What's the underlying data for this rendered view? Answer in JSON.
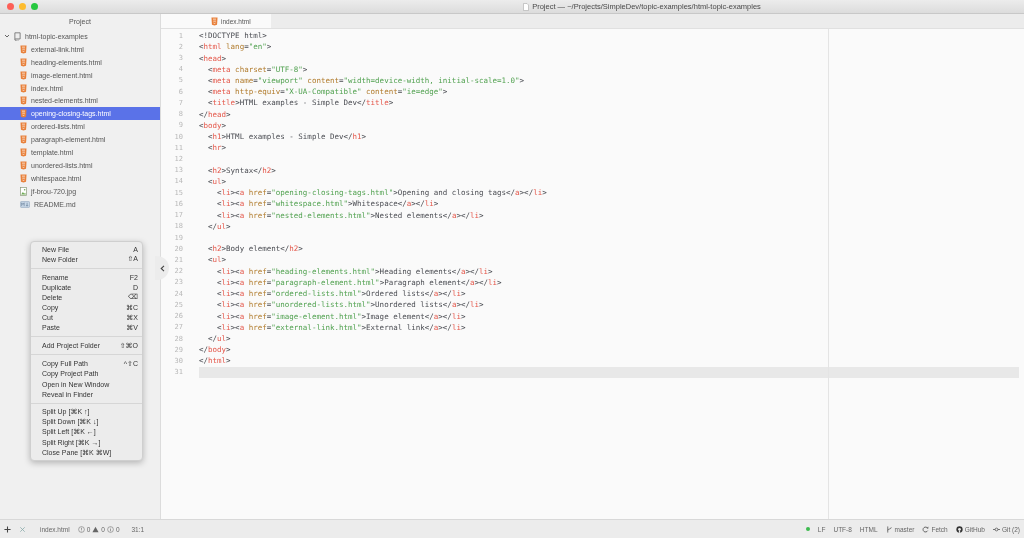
{
  "window": {
    "title": "Project — ~/Projects/SimpleDev/topic-examples/html-topic-examples"
  },
  "sidebar": {
    "title": "Project",
    "tree": [
      {
        "name": "html-topic-examples",
        "kind": "repo",
        "expanded": true,
        "selected": false,
        "children": [
          {
            "name": "external-link.html",
            "kind": "html",
            "selected": false
          },
          {
            "name": "heading-elements.html",
            "kind": "html",
            "selected": false
          },
          {
            "name": "image-element.html",
            "kind": "html",
            "selected": false
          },
          {
            "name": "index.html",
            "kind": "html",
            "selected": false
          },
          {
            "name": "nested-elements.html",
            "kind": "html",
            "selected": false
          },
          {
            "name": "opening-closing-tags.html",
            "kind": "html",
            "selected": true
          },
          {
            "name": "ordered-lists.html",
            "kind": "html",
            "selected": false
          },
          {
            "name": "paragraph-element.html",
            "kind": "html",
            "selected": false
          },
          {
            "name": "template.html",
            "kind": "html",
            "selected": false
          },
          {
            "name": "unordered-lists.html",
            "kind": "html",
            "selected": false
          },
          {
            "name": "whitespace.html",
            "kind": "html",
            "selected": false
          },
          {
            "name": "jf-brou-720.jpg",
            "kind": "image",
            "selected": false
          },
          {
            "name": "README.md",
            "kind": "markdown",
            "selected": false
          }
        ]
      }
    ]
  },
  "context_menu": {
    "groups": [
      [
        {
          "label": "New File",
          "shortcut": "A"
        },
        {
          "label": "New Folder",
          "shortcut": "⇧A"
        }
      ],
      [
        {
          "label": "Rename",
          "shortcut": "F2"
        },
        {
          "label": "Duplicate",
          "shortcut": "D"
        },
        {
          "label": "Delete",
          "shortcut": "⌫"
        },
        {
          "label": "Copy",
          "shortcut": "⌘C"
        },
        {
          "label": "Cut",
          "shortcut": "⌘X"
        },
        {
          "label": "Paste",
          "shortcut": "⌘V"
        }
      ],
      [
        {
          "label": "Add Project Folder",
          "shortcut": "⇧⌘O"
        }
      ],
      [
        {
          "label": "Copy Full Path",
          "shortcut": "^⇧C"
        },
        {
          "label": "Copy Project Path"
        },
        {
          "label": "Open in New Window"
        },
        {
          "label": "Reveal in Finder"
        }
      ],
      [
        {
          "label": "Split Up [⌘K ↑]"
        },
        {
          "label": "Split Down [⌘K ↓]"
        },
        {
          "label": "Split Left [⌘K ←]"
        },
        {
          "label": "Split Right [⌘K →]"
        },
        {
          "label": "Close Pane [⌘K ⌘W]"
        }
      ]
    ]
  },
  "tabs": [
    {
      "label": "index.html",
      "selected": true
    }
  ],
  "editor": {
    "lines": [
      {
        "number": "1",
        "current": false,
        "tokens": [
          {
            "kind": "p",
            "text": "<!DOCTYPE html>"
          }
        ]
      },
      {
        "number": "2",
        "current": false,
        "tokens": [
          {
            "kind": "p",
            "text": "<"
          },
          {
            "kind": "tag",
            "text": "html"
          },
          {
            "kind": "attr",
            "text": " lang"
          },
          {
            "kind": "p",
            "text": "="
          },
          {
            "kind": "str",
            "text": "\"en\""
          },
          {
            "kind": "p",
            "text": ">"
          }
        ]
      },
      {
        "number": "3",
        "current": false,
        "tokens": [
          {
            "kind": "p",
            "text": "<"
          },
          {
            "kind": "tag",
            "text": "head"
          },
          {
            "kind": "p",
            "text": ">"
          }
        ]
      },
      {
        "number": "4",
        "current": false,
        "tokens": [
          {
            "kind": "p",
            "text": "  <"
          },
          {
            "kind": "tag",
            "text": "meta"
          },
          {
            "kind": "attr",
            "text": " charset"
          },
          {
            "kind": "p",
            "text": "="
          },
          {
            "kind": "str",
            "text": "\"UTF-8\""
          },
          {
            "kind": "p",
            "text": ">"
          }
        ]
      },
      {
        "number": "5",
        "current": false,
        "tokens": [
          {
            "kind": "p",
            "text": "  <"
          },
          {
            "kind": "tag",
            "text": "meta"
          },
          {
            "kind": "attr",
            "text": " name"
          },
          {
            "kind": "p",
            "text": "="
          },
          {
            "kind": "str",
            "text": "\"viewport\""
          },
          {
            "kind": "attr",
            "text": " content"
          },
          {
            "kind": "p",
            "text": "="
          },
          {
            "kind": "str",
            "text": "\"width=device-width, initial-scale=1.0\""
          },
          {
            "kind": "p",
            "text": ">"
          }
        ]
      },
      {
        "number": "6",
        "current": false,
        "tokens": [
          {
            "kind": "p",
            "text": "  <"
          },
          {
            "kind": "tag",
            "text": "meta"
          },
          {
            "kind": "attr",
            "text": " http-equiv"
          },
          {
            "kind": "p",
            "text": "="
          },
          {
            "kind": "str",
            "text": "\"X-UA-Compatible\""
          },
          {
            "kind": "attr",
            "text": " content"
          },
          {
            "kind": "p",
            "text": "="
          },
          {
            "kind": "str",
            "text": "\"ie=edge\""
          },
          {
            "kind": "p",
            "text": ">"
          }
        ]
      },
      {
        "number": "7",
        "current": false,
        "tokens": [
          {
            "kind": "p",
            "text": "  <"
          },
          {
            "kind": "tag",
            "text": "title"
          },
          {
            "kind": "p",
            "text": ">HTML examples - Simple Dev</"
          },
          {
            "kind": "tag",
            "text": "title"
          },
          {
            "kind": "p",
            "text": ">"
          }
        ]
      },
      {
        "number": "8",
        "current": false,
        "tokens": [
          {
            "kind": "p",
            "text": "</"
          },
          {
            "kind": "tag",
            "text": "head"
          },
          {
            "kind": "p",
            "text": ">"
          }
        ]
      },
      {
        "number": "9",
        "current": false,
        "tokens": [
          {
            "kind": "p",
            "text": "<"
          },
          {
            "kind": "tag",
            "text": "body"
          },
          {
            "kind": "p",
            "text": ">"
          }
        ]
      },
      {
        "number": "10",
        "current": false,
        "tokens": [
          {
            "kind": "p",
            "text": "  <"
          },
          {
            "kind": "tag",
            "text": "h1"
          },
          {
            "kind": "p",
            "text": ">HTML examples - Simple Dev</"
          },
          {
            "kind": "tag",
            "text": "h1"
          },
          {
            "kind": "p",
            "text": ">"
          }
        ]
      },
      {
        "number": "11",
        "current": false,
        "tokens": [
          {
            "kind": "p",
            "text": "  <"
          },
          {
            "kind": "tag",
            "text": "hr"
          },
          {
            "kind": "p",
            "text": ">"
          }
        ]
      },
      {
        "number": "12",
        "current": false
      },
      {
        "number": "13",
        "current": false,
        "tokens": [
          {
            "kind": "p",
            "text": "  <"
          },
          {
            "kind": "tag",
            "text": "h2"
          },
          {
            "kind": "p",
            "text": ">Syntax</"
          },
          {
            "kind": "tag",
            "text": "h2"
          },
          {
            "kind": "p",
            "text": ">"
          }
        ]
      },
      {
        "number": "14",
        "current": false,
        "tokens": [
          {
            "kind": "p",
            "text": "  <"
          },
          {
            "kind": "tag",
            "text": "ul"
          },
          {
            "kind": "p",
            "text": ">"
          }
        ]
      },
      {
        "number": "15",
        "current": false,
        "tokens": [
          {
            "kind": "p",
            "text": "    <"
          },
          {
            "kind": "tag",
            "text": "li"
          },
          {
            "kind": "p",
            "text": "><"
          },
          {
            "kind": "tag",
            "text": "a"
          },
          {
            "kind": "attr",
            "text": " href"
          },
          {
            "kind": "p",
            "text": "="
          },
          {
            "kind": "str",
            "text": "\"opening-closing-tags.html\""
          },
          {
            "kind": "p",
            "text": ">Opening and closing tags</"
          },
          {
            "kind": "tag",
            "text": "a"
          },
          {
            "kind": "p",
            "text": "></"
          },
          {
            "kind": "tag",
            "text": "li"
          },
          {
            "kind": "p",
            "text": ">"
          }
        ]
      },
      {
        "number": "16",
        "current": false,
        "tokens": [
          {
            "kind": "p",
            "text": "    <"
          },
          {
            "kind": "tag",
            "text": "li"
          },
          {
            "kind": "p",
            "text": "><"
          },
          {
            "kind": "tag",
            "text": "a"
          },
          {
            "kind": "attr",
            "text": " href"
          },
          {
            "kind": "p",
            "text": "="
          },
          {
            "kind": "str",
            "text": "\"whitespace.html\""
          },
          {
            "kind": "p",
            "text": ">Whitespace</"
          },
          {
            "kind": "tag",
            "text": "a"
          },
          {
            "kind": "p",
            "text": "></"
          },
          {
            "kind": "tag",
            "text": "li"
          },
          {
            "kind": "p",
            "text": ">"
          }
        ]
      },
      {
        "number": "17",
        "current": false,
        "tokens": [
          {
            "kind": "p",
            "text": "    <"
          },
          {
            "kind": "tag",
            "text": "li"
          },
          {
            "kind": "p",
            "text": "><"
          },
          {
            "kind": "tag",
            "text": "a"
          },
          {
            "kind": "attr",
            "text": " href"
          },
          {
            "kind": "p",
            "text": "="
          },
          {
            "kind": "str",
            "text": "\"nested-elements.html\""
          },
          {
            "kind": "p",
            "text": ">Nested elements</"
          },
          {
            "kind": "tag",
            "text": "a"
          },
          {
            "kind": "p",
            "text": "></"
          },
          {
            "kind": "tag",
            "text": "li"
          },
          {
            "kind": "p",
            "text": ">"
          }
        ]
      },
      {
        "number": "18",
        "current": false,
        "tokens": [
          {
            "kind": "p",
            "text": "  </"
          },
          {
            "kind": "tag",
            "text": "ul"
          },
          {
            "kind": "p",
            "text": ">"
          }
        ]
      },
      {
        "number": "19",
        "current": false
      },
      {
        "number": "20",
        "current": false,
        "tokens": [
          {
            "kind": "p",
            "text": "  <"
          },
          {
            "kind": "tag",
            "text": "h2"
          },
          {
            "kind": "p",
            "text": ">Body element</"
          },
          {
            "kind": "tag",
            "text": "h2"
          },
          {
            "kind": "p",
            "text": ">"
          }
        ]
      },
      {
        "number": "21",
        "current": false,
        "tokens": [
          {
            "kind": "p",
            "text": "  <"
          },
          {
            "kind": "tag",
            "text": "ul"
          },
          {
            "kind": "p",
            "text": ">"
          }
        ]
      },
      {
        "number": "22",
        "current": false,
        "tokens": [
          {
            "kind": "p",
            "text": "    <"
          },
          {
            "kind": "tag",
            "text": "li"
          },
          {
            "kind": "p",
            "text": "><"
          },
          {
            "kind": "tag",
            "text": "a"
          },
          {
            "kind": "attr",
            "text": " href"
          },
          {
            "kind": "p",
            "text": "="
          },
          {
            "kind": "str",
            "text": "\"heading-elements.html\""
          },
          {
            "kind": "p",
            "text": ">Heading elements</"
          },
          {
            "kind": "tag",
            "text": "a"
          },
          {
            "kind": "p",
            "text": "></"
          },
          {
            "kind": "tag",
            "text": "li"
          },
          {
            "kind": "p",
            "text": ">"
          }
        ]
      },
      {
        "number": "23",
        "current": false,
        "tokens": [
          {
            "kind": "p",
            "text": "    <"
          },
          {
            "kind": "tag",
            "text": "li"
          },
          {
            "kind": "p",
            "text": "><"
          },
          {
            "kind": "tag",
            "text": "a"
          },
          {
            "kind": "attr",
            "text": " href"
          },
          {
            "kind": "p",
            "text": "="
          },
          {
            "kind": "str",
            "text": "\"paragraph-element.html\""
          },
          {
            "kind": "p",
            "text": ">Paragraph element</"
          },
          {
            "kind": "tag",
            "text": "a"
          },
          {
            "kind": "p",
            "text": "></"
          },
          {
            "kind": "tag",
            "text": "li"
          },
          {
            "kind": "p",
            "text": ">"
          }
        ]
      },
      {
        "number": "24",
        "current": false,
        "tokens": [
          {
            "kind": "p",
            "text": "    <"
          },
          {
            "kind": "tag",
            "text": "li"
          },
          {
            "kind": "p",
            "text": "><"
          },
          {
            "kind": "tag",
            "text": "a"
          },
          {
            "kind": "attr",
            "text": " href"
          },
          {
            "kind": "p",
            "text": "="
          },
          {
            "kind": "str",
            "text": "\"ordered-lists.html\""
          },
          {
            "kind": "p",
            "text": ">Ordered lists</"
          },
          {
            "kind": "tag",
            "text": "a"
          },
          {
            "kind": "p",
            "text": "></"
          },
          {
            "kind": "tag",
            "text": "li"
          },
          {
            "kind": "p",
            "text": ">"
          }
        ]
      },
      {
        "number": "25",
        "current": false,
        "tokens": [
          {
            "kind": "p",
            "text": "    <"
          },
          {
            "kind": "tag",
            "text": "li"
          },
          {
            "kind": "p",
            "text": "><"
          },
          {
            "kind": "tag",
            "text": "a"
          },
          {
            "kind": "attr",
            "text": " href"
          },
          {
            "kind": "p",
            "text": "="
          },
          {
            "kind": "str",
            "text": "\"unordered-lists.html\""
          },
          {
            "kind": "p",
            "text": ">Unordered lists</"
          },
          {
            "kind": "tag",
            "text": "a"
          },
          {
            "kind": "p",
            "text": "></"
          },
          {
            "kind": "tag",
            "text": "li"
          },
          {
            "kind": "p",
            "text": ">"
          }
        ]
      },
      {
        "number": "26",
        "current": false,
        "tokens": [
          {
            "kind": "p",
            "text": "    <"
          },
          {
            "kind": "tag",
            "text": "li"
          },
          {
            "kind": "p",
            "text": "><"
          },
          {
            "kind": "tag",
            "text": "a"
          },
          {
            "kind": "attr",
            "text": " href"
          },
          {
            "kind": "p",
            "text": "="
          },
          {
            "kind": "str",
            "text": "\"image-element.html\""
          },
          {
            "kind": "p",
            "text": ">Image element</"
          },
          {
            "kind": "tag",
            "text": "a"
          },
          {
            "kind": "p",
            "text": "></"
          },
          {
            "kind": "tag",
            "text": "li"
          },
          {
            "kind": "p",
            "text": ">"
          }
        ]
      },
      {
        "number": "27",
        "current": false,
        "tokens": [
          {
            "kind": "p",
            "text": "    <"
          },
          {
            "kind": "tag",
            "text": "li"
          },
          {
            "kind": "p",
            "text": "><"
          },
          {
            "kind": "tag",
            "text": "a"
          },
          {
            "kind": "attr",
            "text": " href"
          },
          {
            "kind": "p",
            "text": "="
          },
          {
            "kind": "str",
            "text": "\"external-link.html\""
          },
          {
            "kind": "p",
            "text": ">External link</"
          },
          {
            "kind": "tag",
            "text": "a"
          },
          {
            "kind": "p",
            "text": "></"
          },
          {
            "kind": "tag",
            "text": "li"
          },
          {
            "kind": "p",
            "text": ">"
          }
        ]
      },
      {
        "number": "28",
        "current": false,
        "tokens": [
          {
            "kind": "p",
            "text": "  </"
          },
          {
            "kind": "tag",
            "text": "ul"
          },
          {
            "kind": "p",
            "text": ">"
          }
        ]
      },
      {
        "number": "29",
        "current": false,
        "tokens": [
          {
            "kind": "p",
            "text": "</"
          },
          {
            "kind": "tag",
            "text": "body"
          },
          {
            "kind": "p",
            "text": ">"
          }
        ]
      },
      {
        "number": "30",
        "current": false,
        "tokens": [
          {
            "kind": "p",
            "text": "</"
          },
          {
            "kind": "tag",
            "text": "html"
          },
          {
            "kind": "p",
            "text": ">"
          }
        ]
      },
      {
        "number": "31",
        "current": true
      }
    ]
  },
  "status_bar": {
    "file": "index.html",
    "errors": "0",
    "warnings": "0",
    "infos": "0",
    "cursor": "31:1",
    "line_ending": "LF",
    "encoding": "UTF-8",
    "grammar": "HTML",
    "branch": "master",
    "fetch": "Fetch",
    "github": "GitHub",
    "git": "Git (2)"
  }
}
